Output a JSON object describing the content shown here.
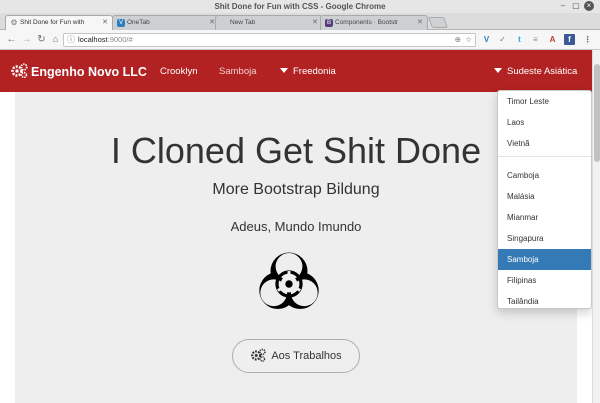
{
  "window": {
    "title": "Shit Done for Fun with CSS - Google Chrome"
  },
  "tabs": [
    {
      "title": "Shit Done for Fun with",
      "favicon": "page-icon",
      "active": true
    },
    {
      "title": "OneTab",
      "favicon": "onetab-icon",
      "active": false
    },
    {
      "title": "New Tab",
      "favicon": "none",
      "active": false
    },
    {
      "title": "Components · Bootstr",
      "favicon": "bootstrap-icon",
      "active": false
    }
  ],
  "toolbar": {
    "url_host": "localhost",
    "url_path": ":9000/#"
  },
  "navbar": {
    "brand": "Engenho Novo LLC",
    "links": [
      "Crooklyn",
      "Samboja"
    ],
    "dropdown_left": "Freedonia",
    "dropdown_right": "Sudeste Asiática",
    "color": "#b22222"
  },
  "menu": {
    "group1": [
      "Timor Leste",
      "Laos",
      "Vietnã"
    ],
    "group2": [
      "Camboja",
      "Malásia",
      "Mianmar",
      "Singapura",
      "Samboja",
      "Filipinas",
      "Tailândia"
    ],
    "active": "Samboja",
    "active_color": "#337ab7"
  },
  "hero": {
    "heading": "I Cloned Get Shit Done",
    "subheading": "More Bootstrap Bildung",
    "text": "Adeus, Mundo Imundo",
    "button_label": "Aos Trabalhos"
  }
}
